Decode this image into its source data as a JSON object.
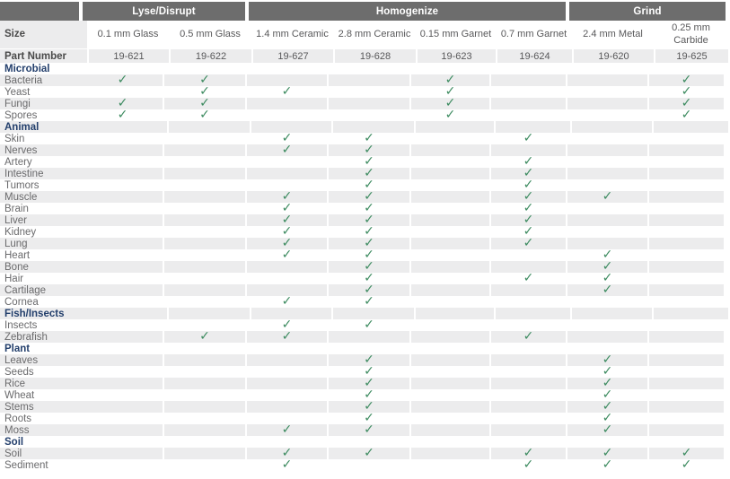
{
  "table": {
    "groups": [
      {
        "label": "",
        "span": 1,
        "kind": "rowlabel"
      },
      {
        "label": "Lyse/Disrupt",
        "span": 2
      },
      {
        "label": "Homogenize",
        "span": 4
      },
      {
        "label": "Grind",
        "span": 2
      }
    ],
    "row_header_labels": {
      "size": "Size",
      "part_number": "Part Number"
    },
    "columns": [
      {
        "size": "0.1 mm Glass",
        "part_number": "19-621"
      },
      {
        "size": "0.5 mm Glass",
        "part_number": "19-622"
      },
      {
        "size": "1.4 mm Ceramic",
        "part_number": "19-627"
      },
      {
        "size": "2.8 mm Ceramic",
        "part_number": "19-628"
      },
      {
        "size": "0.15 mm Garnet",
        "part_number": "19-623"
      },
      {
        "size": "0.7 mm Garnet",
        "part_number": "19-624"
      },
      {
        "size": "2.4 mm Metal",
        "part_number": "19-620"
      },
      {
        "size": "0.25 mm Carbide",
        "part_number": "19-625"
      }
    ],
    "check_glyph": "✓",
    "check_color": "#3d8b60",
    "header_bar_color": "#6d6d6d",
    "stripe_color": "#ececed",
    "section_color": "#233f6c",
    "sections": [
      {
        "name": "Microbial",
        "rows": [
          {
            "label": "Bacteria",
            "checks": [
              1,
              1,
              0,
              0,
              1,
              0,
              0,
              1
            ]
          },
          {
            "label": "Yeast",
            "checks": [
              0,
              1,
              1,
              0,
              1,
              0,
              0,
              1
            ]
          },
          {
            "label": "Fungi",
            "checks": [
              1,
              1,
              0,
              0,
              1,
              0,
              0,
              1
            ]
          },
          {
            "label": "Spores",
            "checks": [
              1,
              1,
              0,
              0,
              1,
              0,
              0,
              1
            ]
          }
        ]
      },
      {
        "name": "Animal",
        "rows": [
          {
            "label": "Skin",
            "checks": [
              0,
              0,
              1,
              1,
              0,
              1,
              0,
              0
            ]
          },
          {
            "label": "Nerves",
            "checks": [
              0,
              0,
              1,
              1,
              0,
              0,
              0,
              0
            ]
          },
          {
            "label": "Artery",
            "checks": [
              0,
              0,
              0,
              1,
              0,
              1,
              0,
              0
            ]
          },
          {
            "label": "Intestine",
            "checks": [
              0,
              0,
              0,
              1,
              0,
              1,
              0,
              0
            ]
          },
          {
            "label": "Tumors",
            "checks": [
              0,
              0,
              0,
              1,
              0,
              1,
              0,
              0
            ]
          },
          {
            "label": "Muscle",
            "checks": [
              0,
              0,
              1,
              1,
              0,
              1,
              1,
              0
            ]
          },
          {
            "label": "Brain",
            "checks": [
              0,
              0,
              1,
              1,
              0,
              1,
              0,
              0
            ]
          },
          {
            "label": "Liver",
            "checks": [
              0,
              0,
              1,
              1,
              0,
              1,
              0,
              0
            ]
          },
          {
            "label": "Kidney",
            "checks": [
              0,
              0,
              1,
              1,
              0,
              1,
              0,
              0
            ]
          },
          {
            "label": "Lung",
            "checks": [
              0,
              0,
              1,
              1,
              0,
              1,
              0,
              0
            ]
          },
          {
            "label": "Heart",
            "checks": [
              0,
              0,
              1,
              1,
              0,
              0,
              1,
              0
            ]
          },
          {
            "label": "Bone",
            "checks": [
              0,
              0,
              0,
              1,
              0,
              0,
              1,
              0
            ]
          },
          {
            "label": "Hair",
            "checks": [
              0,
              0,
              0,
              1,
              0,
              1,
              1,
              0
            ]
          },
          {
            "label": "Cartilage",
            "checks": [
              0,
              0,
              0,
              1,
              0,
              0,
              1,
              0
            ]
          },
          {
            "label": "Cornea",
            "checks": [
              0,
              0,
              1,
              1,
              0,
              0,
              0,
              0
            ]
          }
        ]
      },
      {
        "name": "Fish/Insects",
        "rows": [
          {
            "label": "Insects",
            "checks": [
              0,
              0,
              1,
              1,
              0,
              0,
              0,
              0
            ]
          },
          {
            "label": "Zebrafish",
            "checks": [
              0,
              1,
              1,
              0,
              0,
              1,
              0,
              0
            ]
          }
        ]
      },
      {
        "name": "Plant",
        "rows": [
          {
            "label": "Leaves",
            "checks": [
              0,
              0,
              0,
              1,
              0,
              0,
              1,
              0
            ]
          },
          {
            "label": "Seeds",
            "checks": [
              0,
              0,
              0,
              1,
              0,
              0,
              1,
              0
            ]
          },
          {
            "label": "Rice",
            "checks": [
              0,
              0,
              0,
              1,
              0,
              0,
              1,
              0
            ]
          },
          {
            "label": "Wheat",
            "checks": [
              0,
              0,
              0,
              1,
              0,
              0,
              1,
              0
            ]
          },
          {
            "label": "Stems",
            "checks": [
              0,
              0,
              0,
              1,
              0,
              0,
              1,
              0
            ]
          },
          {
            "label": "Roots",
            "checks": [
              0,
              0,
              0,
              1,
              0,
              0,
              1,
              0
            ]
          },
          {
            "label": "Moss",
            "checks": [
              0,
              0,
              1,
              1,
              0,
              0,
              1,
              0
            ]
          }
        ]
      },
      {
        "name": "Soil",
        "rows": [
          {
            "label": "Soil",
            "checks": [
              0,
              0,
              1,
              1,
              0,
              1,
              1,
              1
            ]
          },
          {
            "label": "Sediment",
            "checks": [
              0,
              0,
              1,
              0,
              0,
              1,
              1,
              1
            ]
          }
        ]
      }
    ]
  }
}
